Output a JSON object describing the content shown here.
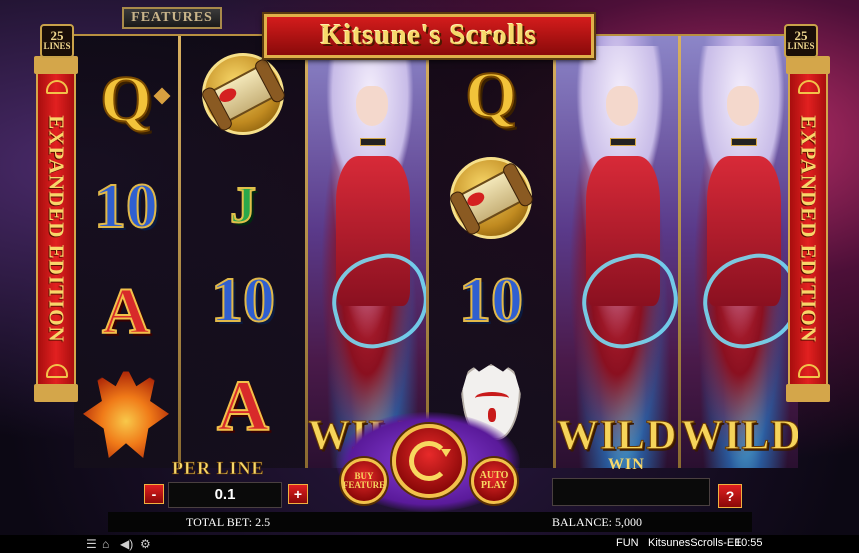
{
  "game": {
    "title": "Kitsune's Scrolls",
    "lines_left": {
      "num": "25",
      "label": "LINES"
    },
    "lines_right": {
      "num": "25",
      "label": "LINES"
    },
    "features_label": "FEATURES",
    "banner_left": "EXPANDED EDITION",
    "banner_right": "EXPANDED EDITION"
  },
  "reels": [
    {
      "type": "symbols",
      "symbols": [
        "Q",
        "10",
        "A",
        "fox"
      ]
    },
    {
      "type": "symbols",
      "symbols": [
        "scroll",
        "J",
        "10",
        "A"
      ]
    },
    {
      "type": "wild",
      "wild_label": "WILD"
    },
    {
      "type": "symbols",
      "symbols": [
        "Q",
        "scroll",
        "10",
        "mask"
      ]
    },
    {
      "type": "wild",
      "wild_label": "WILD"
    },
    {
      "type": "wild",
      "wild_label": "WILD"
    }
  ],
  "controls": {
    "per_line_label": "PER LINE",
    "bet_per_line": "0.1",
    "minus": "-",
    "plus": "+",
    "buy_feature": "BUY FEATURE",
    "auto_play": "AUTO PLAY",
    "win_label": "WIN",
    "win_value": "",
    "help": "?"
  },
  "status": {
    "total_bet": "TOTAL BET: 2.5",
    "balance": "BALANCE: 5,000"
  },
  "system_bar": {
    "icons": [
      "menu-icon",
      "home-icon",
      "sound-icon",
      "settings-icon"
    ],
    "mode": "FUN",
    "game_id": "KitsunesScrolls-EE",
    "clock": "10:55"
  },
  "colors": {
    "accent_gold": "#f6d86a",
    "accent_red": "#d41c1c"
  }
}
